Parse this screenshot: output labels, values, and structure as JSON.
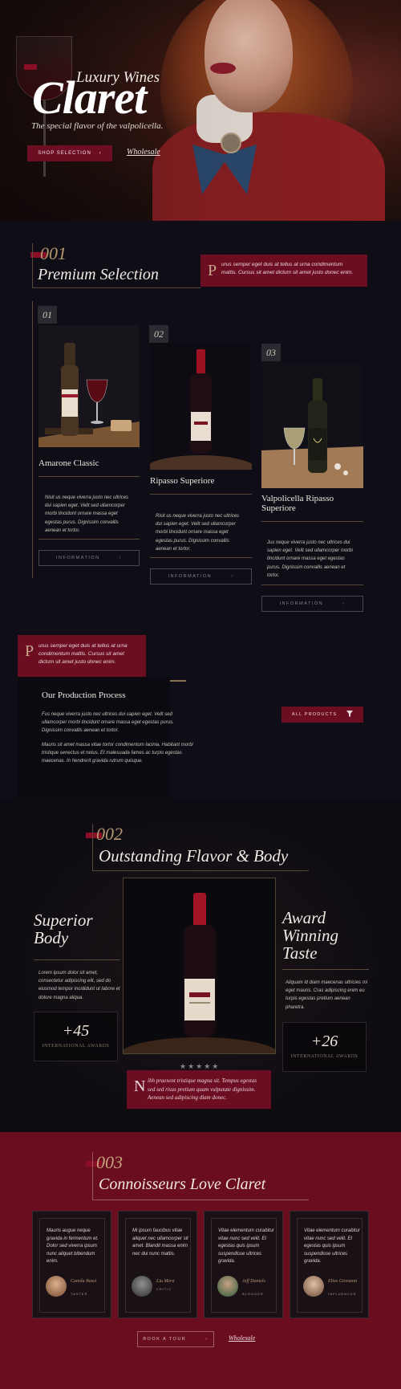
{
  "hero": {
    "subtitle": "Luxury Wines",
    "title": "Claret",
    "tagline": "The special flavor of the valpolicella.",
    "shop_button": "SHOP SELECTION",
    "shop_arrow": "›",
    "wholesale_link": "Wholesale"
  },
  "premium": {
    "number": "001",
    "title": "Premium Selection",
    "callout_cap": "P",
    "callout_text": "urus semper eget duis at tellus at urna condimentum mattis. Cursus sit amet dictum sit amet justo donec enim.",
    "wines": [
      {
        "num": "01",
        "name": "Amarone Classic",
        "text": "Nisit us neque viverra justo nec ultrices dui sapien eget. Velit sed ullamcorper morbi tincidunt ornare massa eget egestas purus. Dignissim convallis aenean et tortor.",
        "button": "INFORMATION",
        "arrow": "›"
      },
      {
        "num": "02",
        "name": "Ripasso Superiore",
        "text": "Risit us neque viverra justo nec ultrices dui sapien eget. Velit sed ullamcorper morbi tincidunt ornare massa eget egestas purus. Dignissim convallis aenean et tortor.",
        "button": "INFORMATION",
        "arrow": "›"
      },
      {
        "num": "03",
        "name": "Valpolicella Ripasso Superiore",
        "text": "Jus neque viverra justo nec ultrices dui sapien eget. Velit sed ullamcorper morbi tincidunt ornare massa eget egestas purus. Dignissim convallis aenean et tortor.",
        "button": "INFORMATION",
        "arrow": "›"
      }
    ],
    "callout2_cap": "P",
    "callout2_text": "urus semper eget duis at tellus at urna condimentum mattis. Cursus sit amet dictum sit amet justo donec enim.",
    "process_title": "Our Production Process",
    "process_p1": "Fus neque viverra justo nec ultrices dui sapien eget. Velit sed ullamcorper morbi tincidunt ornare massa eget egestas purus. Dignissim convallis aenean et tortor.",
    "process_p2": "Mauris sit amet massa vitae tortor condimentum lacinia. Habitant morbi tristique senectus et netus. Et malesuada fames ac turpis egestas maecenas. In hendrerit gravida rutrum quisque.",
    "all_products": "ALL PRODUCTS",
    "filter_icon": "filter-icon"
  },
  "flavor": {
    "number": "002",
    "title": "Outstanding Flavor & Body",
    "left_head": "Superior Body",
    "left_text": "Lorem ipsum dolor sit amet, consectetur adipiscing elit, sed do eiusmod tempor incididunt ut labore et dolore magna aliqua.",
    "left_stat": "+45",
    "left_stat_label": "INTERNATIONAL AWARDS",
    "right_head": "Award Winning Taste",
    "right_text": "Aliquam id diam maecenas ultricies mi eget mauris. Cras adipiscing enim eu turpis egestas pretium aenean pharetra.",
    "right_stat": "+26",
    "right_stat_label": "INTERNATIONAL AWARDS",
    "stars": "★★★★★",
    "quote_cap": "N",
    "quote_text": "ibh praesent tristique magna sit. Tempus egestas sed sed risus pretium quam vulputate dignissim. Aenean sed adipiscing diam donec."
  },
  "reviews": {
    "number": "003",
    "title": "Connoisseurs Love Claret",
    "items": [
      {
        "text": "Mauris augue neque gravida in fermentum et. Dolor sed viverra ipsum nunc aliquet bibendum enim.",
        "name": "Camila Bassi",
        "role": "TASTER"
      },
      {
        "text": "Mi ipsum faucibus vitae aliquet nec ullamcorper sit amet. Blandit massa enim nec dui nunc mattis.",
        "name": "Liu Mera",
        "role": "CRITIC"
      },
      {
        "text": "Vitae elementum curabitur vitae nunc sed velit. Et egestas quis ipsum suspendisse ultrices gravida.",
        "name": "Jeff Daniels",
        "role": "BLOGGER"
      },
      {
        "text": "Vitae elementum curabitur vitae nunc sed velit. Et egestas quis ipsum suspendisse ultrices gravida.",
        "name": "Elios Giovanni",
        "role": "INFLUENCER"
      }
    ],
    "book_button": "BOOK A TOUR",
    "book_arrow": "›",
    "wholesale_link": "Wholesale"
  },
  "colors": {
    "accent": "#6d0d21",
    "gold": "#b59770",
    "dark": "#0f0d15"
  }
}
